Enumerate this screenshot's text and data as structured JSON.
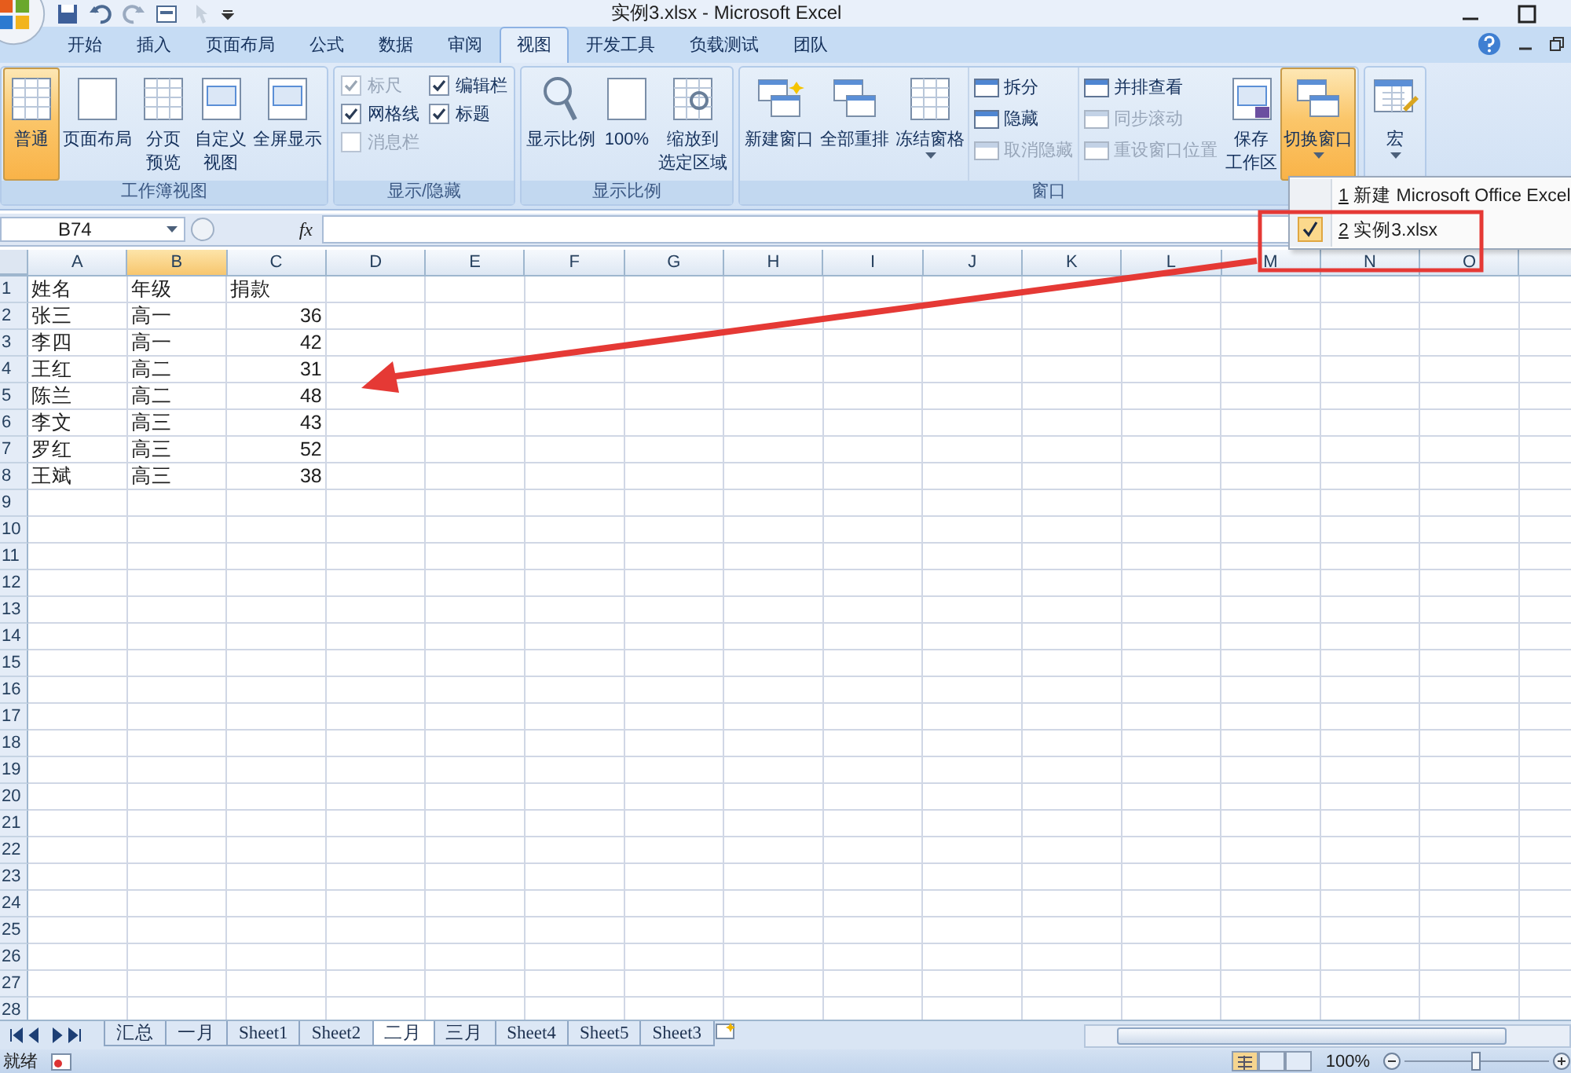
{
  "window": {
    "title": "实例3.xlsx - Microsoft Excel"
  },
  "tabs": [
    {
      "label": "开始",
      "selected": false
    },
    {
      "label": "插入",
      "selected": false
    },
    {
      "label": "页面布局",
      "selected": false
    },
    {
      "label": "公式",
      "selected": false
    },
    {
      "label": "数据",
      "selected": false
    },
    {
      "label": "审阅",
      "selected": false
    },
    {
      "label": "视图",
      "selected": true
    },
    {
      "label": "开发工具",
      "selected": false
    },
    {
      "label": "负载测试",
      "selected": false
    },
    {
      "label": "团队",
      "selected": false
    }
  ],
  "ribbon": {
    "groups": [
      {
        "label": "工作簿视图",
        "items": [
          {
            "kind": "large",
            "lines": [
              "普通"
            ],
            "selected": true,
            "dropdown": false
          },
          {
            "kind": "large",
            "lines": [
              "页面布局"
            ],
            "selected": false,
            "dropdown": false
          },
          {
            "kind": "large",
            "lines": [
              "分页",
              "预览"
            ],
            "selected": false,
            "dropdown": false
          },
          {
            "kind": "large",
            "lines": [
              "自定义",
              "视图"
            ],
            "selected": false,
            "dropdown": false
          },
          {
            "kind": "large",
            "lines": [
              "全屏显示"
            ],
            "selected": false,
            "dropdown": false
          }
        ]
      },
      {
        "label": "显示/隐藏",
        "items": [
          {
            "kind": "checks",
            "items": [
              {
                "label": "标尺",
                "checked": true,
                "disabled": true
              },
              {
                "label": "网格线",
                "checked": true,
                "disabled": false
              },
              {
                "label": "消息栏",
                "checked": false,
                "disabled": true
              }
            ]
          },
          {
            "kind": "checks",
            "items": [
              {
                "label": "编辑栏",
                "checked": true,
                "disabled": false
              },
              {
                "label": "标题",
                "checked": true,
                "disabled": false
              }
            ]
          }
        ]
      },
      {
        "label": "显示比例",
        "items": [
          {
            "kind": "large",
            "lines": [
              "显示比例"
            ],
            "selected": false,
            "dropdown": false
          },
          {
            "kind": "large",
            "lines": [
              "100%"
            ],
            "selected": false,
            "dropdown": false
          },
          {
            "kind": "large",
            "lines": [
              "缩放到",
              "选定区域"
            ],
            "selected": false,
            "dropdown": false
          }
        ]
      },
      {
        "label": "窗口",
        "items": [
          {
            "kind": "large",
            "lines": [
              "新建窗口"
            ],
            "selected": false,
            "dropdown": false
          },
          {
            "kind": "large",
            "lines": [
              "全部重排"
            ],
            "selected": false,
            "dropdown": false
          },
          {
            "kind": "large",
            "lines": [
              "冻结窗格"
            ],
            "selected": false,
            "dropdown": true
          },
          {
            "kind": "smalls",
            "items": [
              {
                "label": "拆分",
                "disabled": false
              },
              {
                "label": "隐藏",
                "disabled": false
              },
              {
                "label": "取消隐藏",
                "disabled": true
              }
            ]
          },
          {
            "kind": "smalls",
            "items": [
              {
                "label": "并排查看",
                "disabled": false
              },
              {
                "label": "同步滚动",
                "disabled": true
              },
              {
                "label": "重设窗口位置",
                "disabled": true
              }
            ]
          },
          {
            "kind": "large",
            "lines": [
              "保存",
              "工作区"
            ],
            "selected": false,
            "dropdown": false
          },
          {
            "kind": "large",
            "lines": [
              "切换窗口"
            ],
            "selected": true,
            "dropdown": true
          }
        ]
      },
      {
        "items": [
          {
            "kind": "large",
            "lines": [
              "宏"
            ],
            "selected": false,
            "dropdown": true
          }
        ]
      }
    ]
  },
  "switch_menu": {
    "items": [
      {
        "number": "1",
        "label": "新建 Microsoft Office Excel",
        "checked": false
      },
      {
        "number": "2",
        "label": "实例3.xlsx",
        "checked": true
      }
    ]
  },
  "formula_bar": {
    "name_box": "B74",
    "function_button": "fx"
  },
  "columns": [
    {
      "label": "A",
      "selected": false
    },
    {
      "label": "B",
      "selected": true
    },
    {
      "label": "C",
      "selected": false
    },
    {
      "label": "D",
      "selected": false
    },
    {
      "label": "E",
      "selected": false
    },
    {
      "label": "F",
      "selected": false
    },
    {
      "label": "G",
      "selected": false
    },
    {
      "label": "H",
      "selected": false
    },
    {
      "label": "I",
      "selected": false
    },
    {
      "label": "J",
      "selected": false
    },
    {
      "label": "K",
      "selected": false
    },
    {
      "label": "L",
      "selected": false
    },
    {
      "label": "M",
      "selected": false
    },
    {
      "label": "N",
      "selected": false
    },
    {
      "label": "O",
      "selected": false
    }
  ],
  "rows": [
    {
      "header": "1",
      "cells": [
        "姓名",
        "年级",
        "捐款"
      ]
    },
    {
      "header": "2",
      "cells": [
        "张三",
        "高一",
        "36"
      ]
    },
    {
      "header": "3",
      "cells": [
        "李四",
        "高一",
        "42"
      ]
    },
    {
      "header": "4",
      "cells": [
        "王红",
        "高二",
        "31"
      ]
    },
    {
      "header": "5",
      "cells": [
        "陈兰",
        "高二",
        "48"
      ]
    },
    {
      "header": "6",
      "cells": [
        "李文",
        "高三",
        "43"
      ]
    },
    {
      "header": "7",
      "cells": [
        "罗红",
        "高三",
        "52"
      ]
    },
    {
      "header": "8",
      "cells": [
        "王斌",
        "高三",
        "38"
      ]
    },
    {
      "header": "9"
    },
    {
      "header": "10"
    },
    {
      "header": "11"
    },
    {
      "header": "12"
    },
    {
      "header": "13"
    },
    {
      "header": "14"
    },
    {
      "header": "15"
    },
    {
      "header": "16"
    },
    {
      "header": "17"
    },
    {
      "header": "18"
    },
    {
      "header": "19"
    },
    {
      "header": "20"
    },
    {
      "header": "21"
    },
    {
      "header": "22"
    },
    {
      "header": "23"
    },
    {
      "header": "24"
    },
    {
      "header": "25"
    },
    {
      "header": "26"
    },
    {
      "header": "27"
    },
    {
      "header": "28"
    }
  ],
  "sheet_tabs": [
    {
      "label": "汇总",
      "selected": false
    },
    {
      "label": "一月",
      "selected": false
    },
    {
      "label": "Sheet1",
      "selected": false
    },
    {
      "label": "Sheet2",
      "selected": false
    },
    {
      "label": "二月",
      "selected": true
    },
    {
      "label": "三月",
      "selected": false
    },
    {
      "label": "Sheet4",
      "selected": false
    },
    {
      "label": "Sheet5",
      "selected": false
    },
    {
      "label": "Sheet3",
      "selected": false
    }
  ],
  "status_bar": {
    "status": "就绪",
    "zoom": "100%"
  }
}
